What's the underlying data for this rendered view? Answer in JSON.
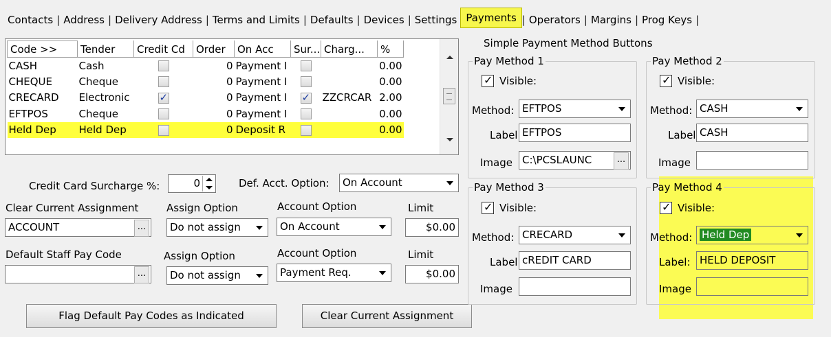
{
  "tabs": [
    {
      "label": "Contacts",
      "active": false
    },
    {
      "label": "Address",
      "active": false
    },
    {
      "label": "Delivery Address",
      "active": false
    },
    {
      "label": "Terms and Limits",
      "active": false
    },
    {
      "label": "Defaults",
      "active": false
    },
    {
      "label": "Devices",
      "active": false
    },
    {
      "label": "Settings",
      "active": false
    },
    {
      "label": "Payments",
      "active": true
    },
    {
      "label": "Operators",
      "active": false
    },
    {
      "label": "Margins",
      "active": false
    },
    {
      "label": "Prog Keys",
      "active": false
    }
  ],
  "grid": {
    "columns": [
      "Code >>",
      "Tender",
      "Credit Cd",
      "Order",
      "On Acc",
      "Sur...",
      "Charg...",
      "%"
    ],
    "rows": [
      {
        "code": "CASH",
        "tender": "Cash",
        "credit": false,
        "order": "0",
        "onacc": "Payment I",
        "sur": false,
        "charge": "",
        "pct": "0.00",
        "selected": false
      },
      {
        "code": "CHEQUE",
        "tender": "Cheque",
        "credit": false,
        "order": "0",
        "onacc": "Payment I",
        "sur": false,
        "charge": "",
        "pct": "0.00",
        "selected": false
      },
      {
        "code": "CRECARD",
        "tender": "Electronic",
        "credit": true,
        "order": "0",
        "onacc": "Payment I",
        "sur": true,
        "charge": "ZZCRCAR",
        "pct": "2.00",
        "selected": false
      },
      {
        "code": "EFTPOS",
        "tender": "Cheque",
        "credit": false,
        "order": "0",
        "onacc": "Payment I",
        "sur": false,
        "charge": "",
        "pct": "0.00",
        "selected": false
      },
      {
        "code": "Held Dep",
        "tender": "Held Dep",
        "credit": false,
        "order": "0",
        "onacc": "Deposit R",
        "sur": false,
        "charge": "",
        "pct": "0.00",
        "selected": true
      }
    ]
  },
  "surcharge": {
    "label": "Credit Card Surcharge %:",
    "value": "0"
  },
  "def_acct": {
    "label": "Def. Acct. Option:",
    "value": "On Account"
  },
  "clear_row": {
    "title": "Clear Current Assignment",
    "value": "ACCOUNT",
    "assign_label": "Assign Option",
    "assign_value": "Do not assign",
    "account_label": "Account Option",
    "account_value": "On Account",
    "limit_label": "Limit",
    "limit_value": "$0.00"
  },
  "staff_row": {
    "title": "Default Staff Pay Code",
    "value": "",
    "assign_label": "Assign Option",
    "assign_value": "Do not assign",
    "account_label": "Account Option",
    "account_value": "Payment Req.",
    "limit_label": "Limit",
    "limit_value": "$0.00"
  },
  "buttons": {
    "flag": "Flag Default Pay Codes as Indicated",
    "clear": "Clear Current Assignment",
    "ellipsis": "..."
  },
  "simple": {
    "title": "Simple Payment Method Buttons",
    "visible_label": "Visible:",
    "method_label": "Method:",
    "label_label": "Label:",
    "image_label": "Image",
    "methods": [
      {
        "title": "Pay Method 1",
        "visible": true,
        "method": "EFTPOS",
        "label": "EFTPOS",
        "image": "C:\\PCSLAUNC"
      },
      {
        "title": "Pay Method 2",
        "visible": true,
        "method": "CASH",
        "label": "CASH",
        "image": ""
      },
      {
        "title": "Pay Method 3",
        "visible": true,
        "method": "CRECARD",
        "label": "cREDIT CARD",
        "image": ""
      },
      {
        "title": "Pay Method 4",
        "visible": true,
        "method": "Held Dep",
        "label": "HELD DEPOSIT",
        "image": ""
      }
    ]
  },
  "colors": {
    "highlight": "#ffff3c",
    "selected_method": "#228b22"
  }
}
